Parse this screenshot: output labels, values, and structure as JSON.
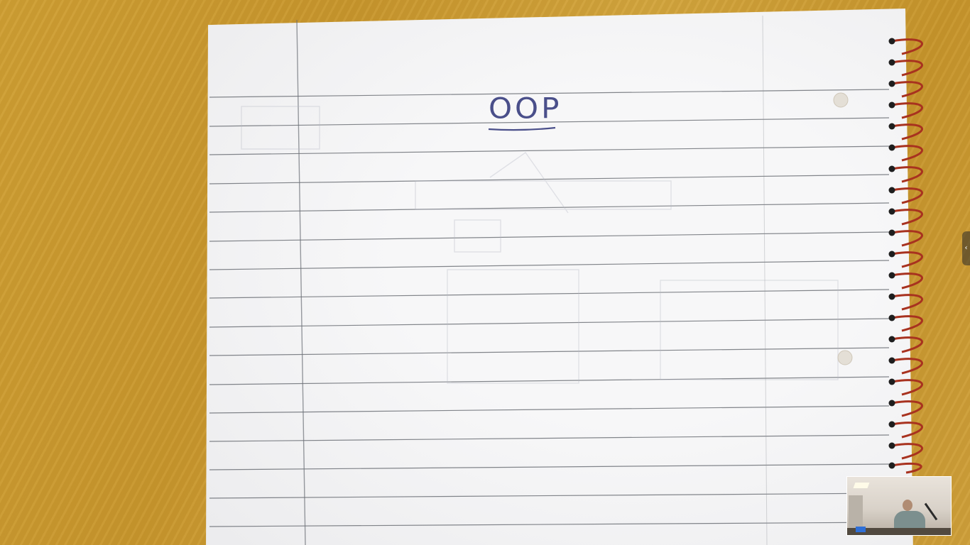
{
  "notebook": {
    "title": "OOP"
  },
  "video": {
    "self_view_label": "",
    "panel_handle_icon": "chevron-left-icon"
  },
  "colors": {
    "desk": "#c9982f",
    "paper": "#f7f7f8",
    "ink": "#4a4f8a",
    "spiral": "#a8321f",
    "ruled_line": "#5b5f66"
  }
}
